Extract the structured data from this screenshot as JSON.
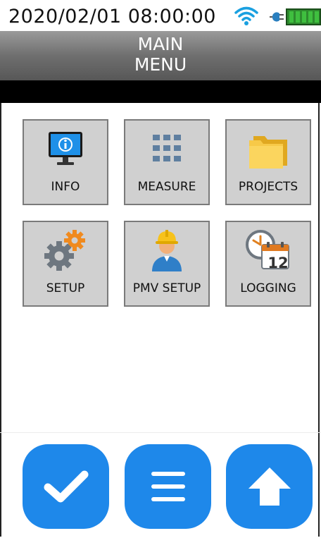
{
  "status": {
    "time": "2020/02/01 08:00:00",
    "icons": [
      "wifi-icon",
      "power-plug-icon",
      "battery-icon"
    ],
    "battery_level": 1.0
  },
  "header": {
    "title_line1": "MAIN",
    "title_line2": "MENU"
  },
  "menu": {
    "tiles": [
      {
        "label": "INFO",
        "icon": "info-monitor-icon"
      },
      {
        "label": "MEASURE",
        "icon": "grid-keypad-icon"
      },
      {
        "label": "PROJECTS",
        "icon": "folder-icon"
      },
      {
        "label": "SETUP",
        "icon": "gears-icon"
      },
      {
        "label": "PMV SETUP",
        "icon": "worker-icon"
      },
      {
        "label": "LOGGING",
        "icon": "clock-calendar-icon",
        "calendar_day": "12"
      }
    ]
  },
  "footer": {
    "buttons": [
      {
        "icon": "check-icon"
      },
      {
        "icon": "menu-icon"
      },
      {
        "icon": "arrow-up-icon"
      }
    ]
  },
  "colors": {
    "accent": "#1e88ea",
    "tile_bg": "#d0d0d0",
    "header_bg": "#6f6f6f"
  }
}
